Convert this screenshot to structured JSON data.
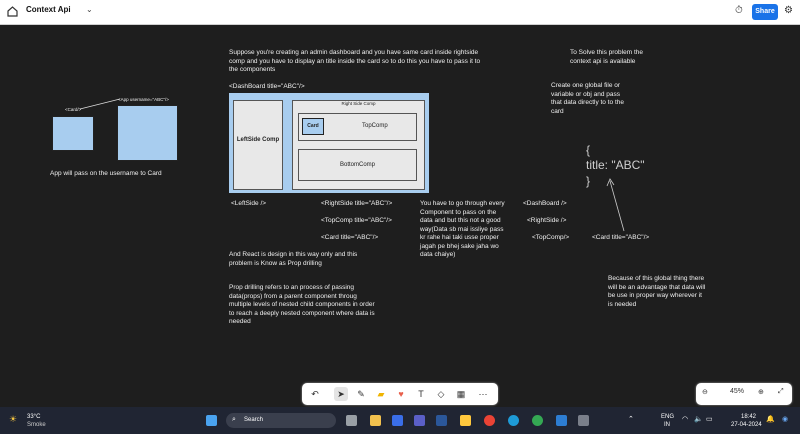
{
  "topbar": {
    "title": "Context Api",
    "share_label": "Share"
  },
  "canvas": {
    "intro_text": "Suppose  you're creating an admin dashboard and you have same card inside rightside comp and you have to display an title inside the card so to do this you have to pass it to the components",
    "dashboard_tag": "<DashBoard title=\"ABC\"/>",
    "left_card_tag": "<Card/>",
    "left_app_tag": "<App username=\"ABC\"/>",
    "app_pass_text": "App will pass on the username to Card",
    "diagram": {
      "right_side_label": "Right Side Comp",
      "leftside_label": "LeftSide Comp",
      "card_label": "Card",
      "topcomp_label": "TopComp",
      "bottomcomp_label": "BottomComp"
    },
    "code_leftside": "<LeftSide />",
    "code_rightside": "<RightSide title=\"ABC\"/>",
    "code_topcomp": "<TopComp title=\"ABC\"/>",
    "code_card": "<Card title=\"ABC\"/>",
    "react_design_text": "And React is design in this way only and this problem is Know as Prop drilling",
    "prop_drilling_text": "Prop drilling refers to an process of passing data(props) from a parent component throug multiple levels of nested child components in order to reach a deeply nested component where data is needed",
    "go_through_text": "You have to go through every Component to pass on the data and but this not a good way(Data sb mai issliye pass kr rahe hai taki usse proper jagah pe bhej sake jaha wo data chaiye)",
    "solve_text": "To Solve this  problem the context api is available",
    "create_global_text": "Create one global file or variable or obj and pass that data directly to to the card",
    "obj_open": "{",
    "obj_title": "title: \"ABC\"",
    "obj_close": "}",
    "right_dashboard": "<DashBoard />",
    "right_rightside": "<RightSide />",
    "right_topcomp": "<TopComp/>",
    "right_card": "<Card title=\"ABC\"/>",
    "because_text": "Because of this global thing there will be an advantage that data will be use in proper way wherever it is needed"
  },
  "zoom": {
    "level": "45%"
  },
  "taskbar": {
    "temp": "33°C",
    "weather": "Smoke",
    "search_placeholder": "Search",
    "lang_top": "ENG",
    "lang_bottom": "IN",
    "time": "18:42",
    "date": "27-04-2024"
  }
}
